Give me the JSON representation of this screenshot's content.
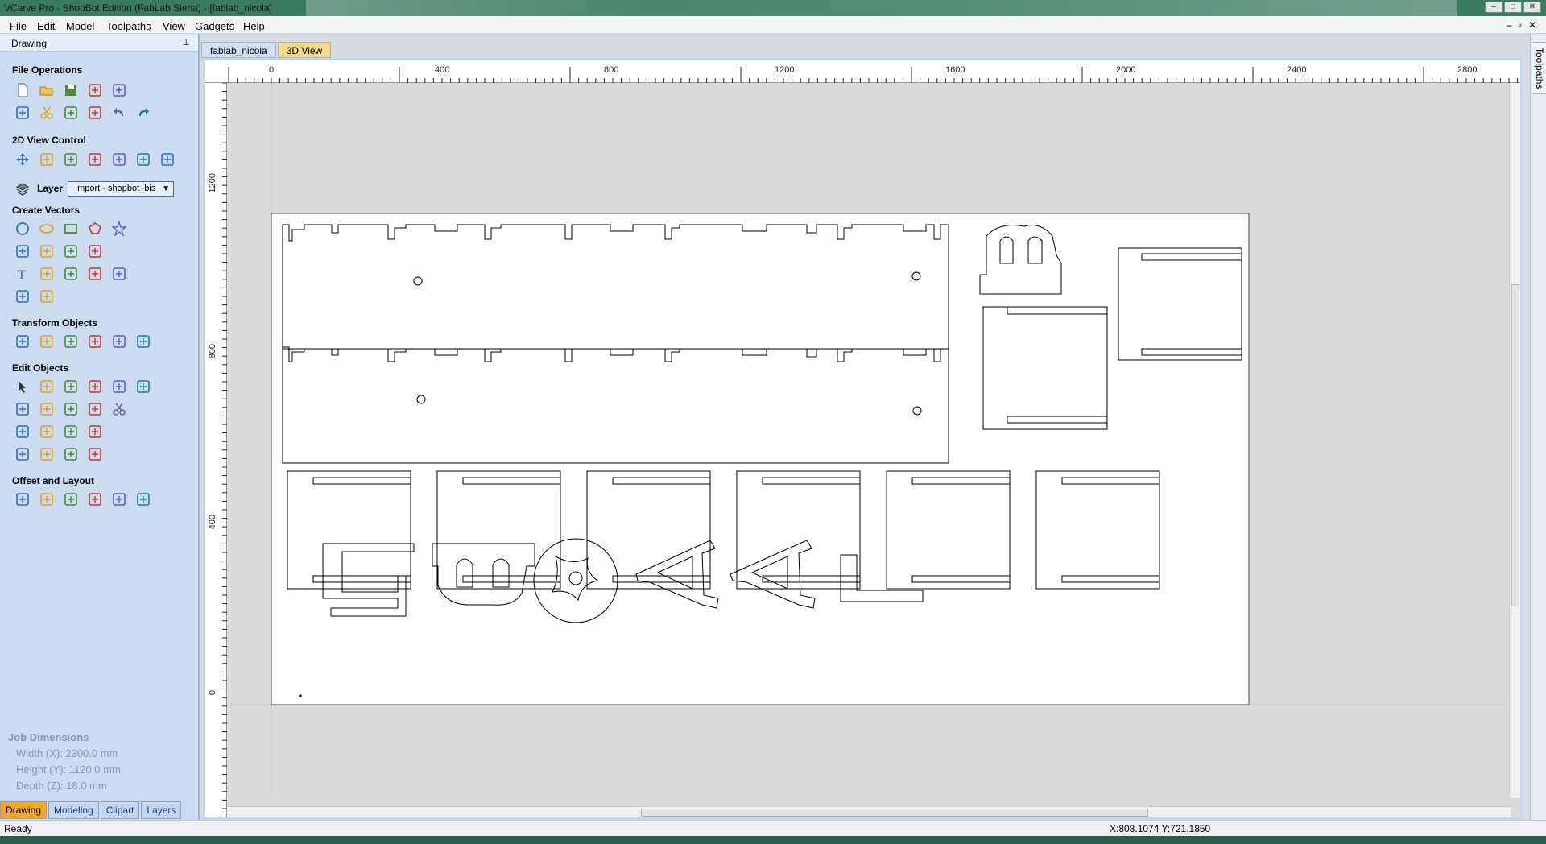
{
  "window": {
    "title": "VCarve Pro - ShopBot Edition (FabLab Siena) - [fablab_nicola]",
    "buttons": [
      "–",
      "□",
      "✕"
    ]
  },
  "menu": {
    "items": [
      "File",
      "Edit",
      "Model",
      "Toolpaths",
      "View",
      "Gadgets",
      "Help"
    ],
    "mdi_buttons": [
      "–",
      "▫",
      "✕"
    ]
  },
  "panel": {
    "title": "Drawing",
    "pin": "⊥",
    "sections": {
      "file_operations": "File Operations",
      "view_control": "2D View Control",
      "layer_label": "Layer",
      "layer_value": "Import - shopbot_bis",
      "create_vectors": "Create Vectors",
      "transform_objects": "Transform Objects",
      "edit_objects": "Edit Objects",
      "offset_layout": "Offset and Layout"
    },
    "job_dimensions": {
      "title": "Job Dimensions",
      "width": "Width  (X): 2300.0 mm",
      "height": "Height (Y): 1120.0 mm",
      "depth": "Depth  (Z): 18.0 mm"
    },
    "bottom_tabs": [
      "Drawing",
      "Modeling",
      "Clipart",
      "Layers"
    ]
  },
  "doc_tabs": [
    "fablab_nicola",
    "3D View"
  ],
  "ruler": {
    "h_labels": [
      "0",
      "400",
      "800",
      "1200",
      "1600",
      "2000",
      "2400",
      "2800"
    ],
    "v_labels": [
      "1200",
      "800",
      "400",
      "0"
    ]
  },
  "right_strip": {
    "tab": "Toolpaths"
  },
  "status": {
    "text": "Ready",
    "coords": "X:808.1074 Y:721.1850"
  },
  "icons": {
    "file_operations": [
      [
        "new-file-icon",
        "open-file-icon",
        "save-icon",
        "import-vectors-icon",
        "import-bitmap-icon"
      ],
      [
        "select-all-icon",
        "cut-icon",
        "copy-icon",
        "paste-icon",
        "undo-icon",
        "redo-icon"
      ]
    ],
    "view_control": [
      "pan-icon",
      "zoom-box-icon",
      "zoom-extents-icon",
      "zoom-selection-icon",
      "split-view-icon",
      "toggle-view-icon",
      "export-view-icon"
    ],
    "create_vectors": [
      [
        "circle-icon",
        "ellipse-icon",
        "rectangle-icon",
        "polygon-icon",
        "star-icon"
      ],
      [
        "polyline-icon",
        "curve-icon",
        "spline-icon",
        "spiral-icon"
      ],
      [
        "text-icon",
        "text-box-icon",
        "text-on-curve-icon",
        "auto-layout-text-icon",
        "abc-text-icon"
      ],
      [
        "trace-bitmap-icon",
        "dimension-icon"
      ]
    ],
    "transform_objects": [
      "move-icon",
      "scale-icon",
      "align-icon",
      "mirror-icon",
      "distort-icon",
      "set-origin-icon"
    ],
    "edit_objects": [
      [
        "select-icon",
        "node-edit-icon",
        "node-add-icon",
        "interactive-trim-icon",
        "delete-icon",
        "smooth-icon"
      ],
      [
        "weld-icon",
        "boolean-icon",
        "subtract-icon",
        "intersect-icon",
        "scissors-icon"
      ],
      [
        "fillet-icon",
        "join-icon",
        "curve-fit-icon",
        "close-vector-icon"
      ],
      [
        "offset-icon",
        "extend-icon",
        "trim-icon",
        "break-icon"
      ]
    ],
    "offset_layout": [
      "offset-vectors-icon",
      "array-copy-icon",
      "circular-array-icon",
      "copy-along-vector-icon",
      "nesting-icon",
      "auto-nest-icon"
    ]
  }
}
